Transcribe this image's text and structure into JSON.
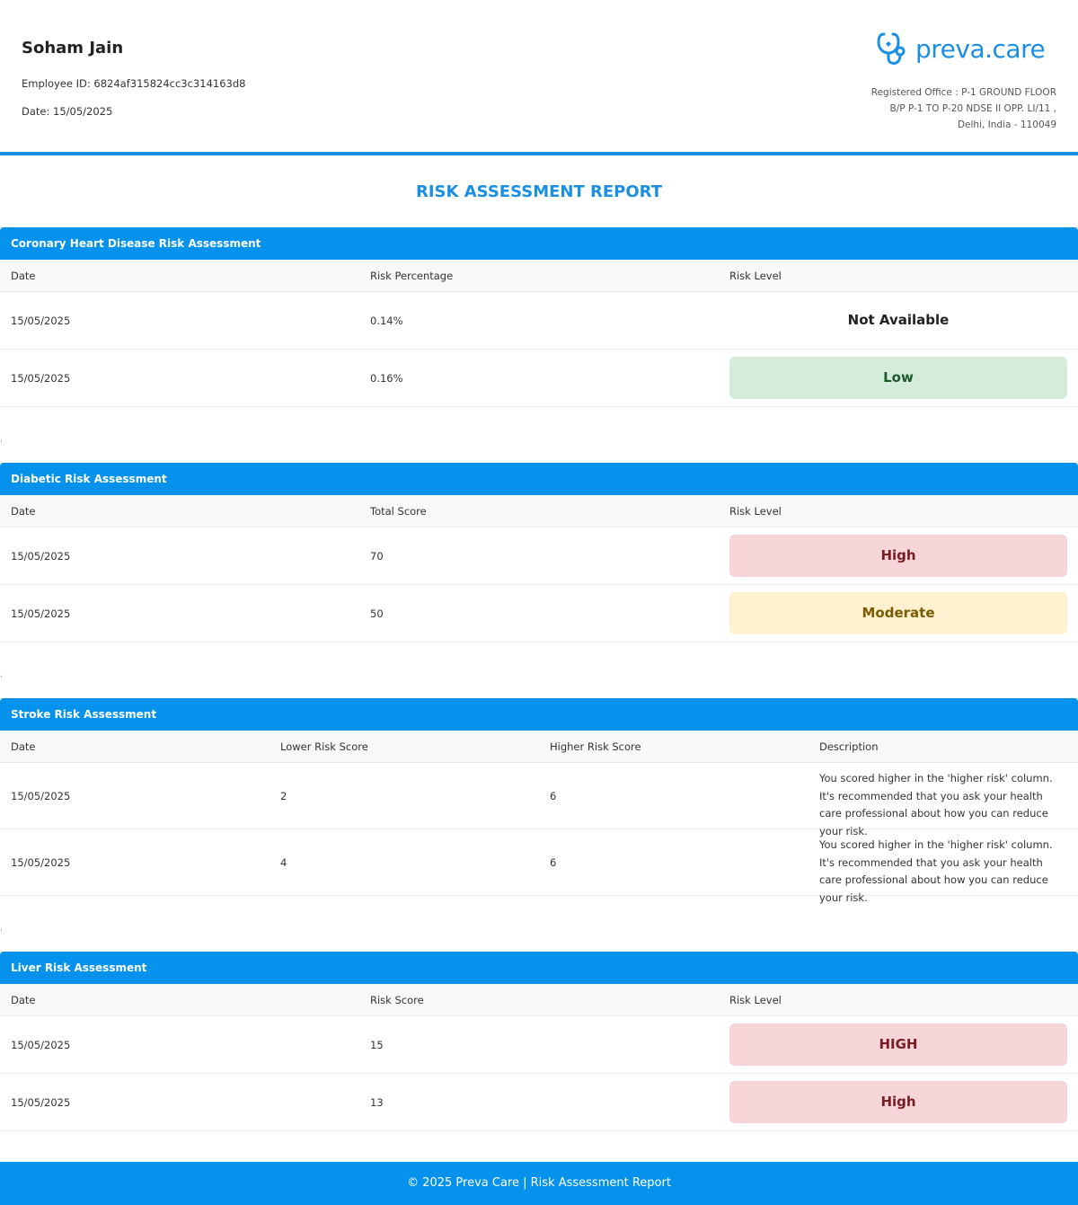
{
  "employee": {
    "name": "Soham Jain",
    "id_line": "Employee ID: 6824af315824cc3c314163d8",
    "date_line": "Date: 15/05/2025"
  },
  "brand": {
    "logo_text": "preva.care",
    "logo_icon": "stethoscope-icon",
    "office_line1": "Registered Office : P-1 GROUND FLOOR",
    "office_line2": "B/P P-1 TO P-20 NDSE II OPP. LI/11 ,",
    "office_line3": "Delhi, India - 110049",
    "accent": "#0592ec"
  },
  "report_title": "RISK ASSESSMENT REPORT",
  "sections": [
    {
      "title": "Coronary Heart Disease Risk Assessment",
      "columns": [
        "Date",
        "Risk Percentage",
        "Risk Level"
      ],
      "rows": [
        {
          "date": "15/05/2025",
          "value": "0.14%",
          "level": "Not Available"
        },
        {
          "date": "15/05/2025",
          "value": "0.16%",
          "level": "Low"
        }
      ]
    },
    {
      "title": "Diabetic Risk Assessment",
      "columns": [
        "Date",
        "Total Score",
        "Risk Level"
      ],
      "rows": [
        {
          "date": "15/05/2025",
          "value": "70",
          "level": "High"
        },
        {
          "date": "15/05/2025",
          "value": "50",
          "level": "Moderate"
        }
      ]
    },
    {
      "title": "Stroke Risk Assessment",
      "columns": [
        "Date",
        "Lower Risk Score",
        "Higher Risk Score",
        "Description"
      ],
      "rows": [
        {
          "date": "15/05/2025",
          "lower": "2",
          "higher": "6",
          "description": "You scored higher in the 'higher risk' column. It's recommended that you ask your health care professional about how you can reduce your risk."
        },
        {
          "date": "15/05/2025",
          "lower": "4",
          "higher": "6",
          "description": "You scored higher in the 'higher risk' column. It's recommended that you ask your health care professional about how you can reduce your risk."
        }
      ]
    },
    {
      "title": "Liver Risk Assessment",
      "columns": [
        "Date",
        "Risk Score",
        "Risk Level"
      ],
      "rows": [
        {
          "date": "15/05/2025",
          "value": "15",
          "level": "HIGH"
        },
        {
          "date": "15/05/2025",
          "value": "13",
          "level": "High"
        }
      ]
    }
  ],
  "separator_mark": ",",
  "footer": "© 2025 Preva Care | Risk Assessment Report"
}
